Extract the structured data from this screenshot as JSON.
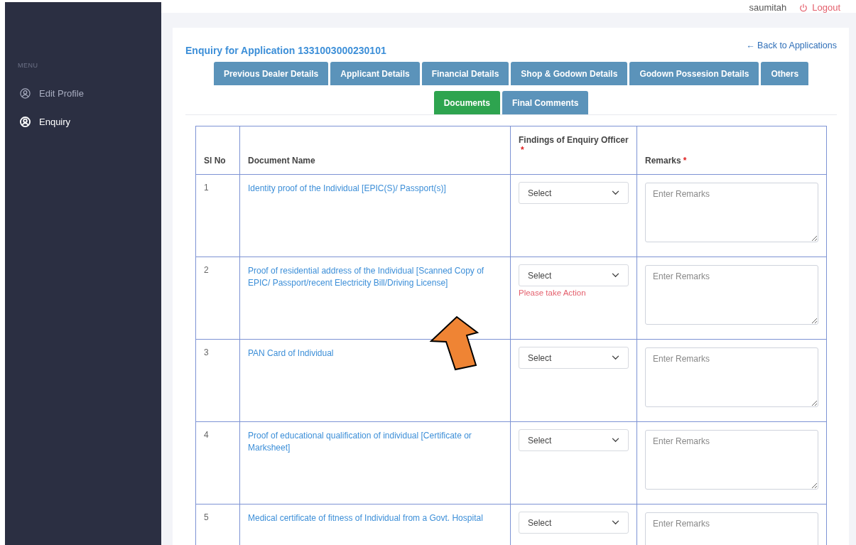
{
  "header": {
    "user": "saumitah",
    "logout": "Logout"
  },
  "sidebar": {
    "menu_label": "MENU",
    "items": [
      {
        "label": "Edit Profile",
        "selected": false
      },
      {
        "label": "Enquiry",
        "selected": true
      }
    ]
  },
  "page": {
    "title": "Enquiry for Application 1331003000230101",
    "back_link": "← Back to Applications"
  },
  "tabs": [
    {
      "label": "Previous Dealer Details",
      "selected": false
    },
    {
      "label": "Applicant Details",
      "selected": false
    },
    {
      "label": "Financial Details",
      "selected": false
    },
    {
      "label": "Shop & Godown Details",
      "selected": false
    },
    {
      "label": "Godown Possesion Details",
      "selected": false
    },
    {
      "label": "Others",
      "selected": false
    },
    {
      "label": "Documents",
      "selected": true
    },
    {
      "label": "Final Comments",
      "selected": false
    }
  ],
  "table": {
    "columns": [
      {
        "label": "Sl No"
      },
      {
        "label": "Document Name"
      },
      {
        "label": "Findings of Enquiry Officer",
        "required_mark": "*"
      },
      {
        "label": "Remarks",
        "required_mark": "*"
      }
    ],
    "rows": [
      {
        "sl": "1",
        "document": "Identity proof of the Individual [EPIC(S)/ Passport(s)]",
        "finding": "Select",
        "remarks_placeholder": "Enter Remarks"
      },
      {
        "sl": "2",
        "document": "Proof of residential address of the Individual [Scanned Copy of EPIC/ Passport/recent Electricity Bill/Driving License]",
        "finding": "Select",
        "error": "Please take Action",
        "remarks_placeholder": "Enter Remarks"
      },
      {
        "sl": "3",
        "document": "PAN Card of Individual",
        "finding": "Select",
        "remarks_placeholder": "Enter Remarks"
      },
      {
        "sl": "4",
        "document": "Proof of educational qualification of individual [Certificate or Marksheet]",
        "finding": "Select",
        "remarks_placeholder": "Enter Remarks"
      },
      {
        "sl": "5",
        "document": "Medical certificate of fitness of Individual from a Govt. Hospital",
        "finding": "Select",
        "remarks_placeholder": "Enter Remarks"
      }
    ]
  }
}
